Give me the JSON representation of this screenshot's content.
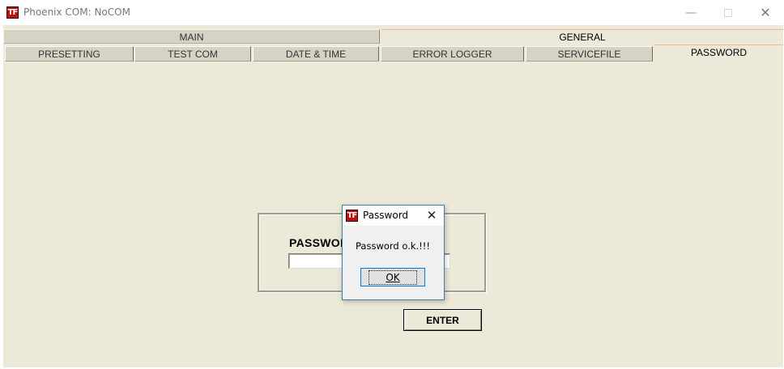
{
  "window": {
    "icon_text": "TF",
    "title": "Phoenix COM: NoCOM"
  },
  "tabs": {
    "main_tabs": [
      {
        "label": "MAIN",
        "selected": false
      },
      {
        "label": "GENERAL",
        "selected": true
      }
    ],
    "sub_tabs": [
      {
        "label": "PRESETTING",
        "selected": false
      },
      {
        "label": "TEST COM",
        "selected": false
      },
      {
        "label": "DATE & TIME",
        "selected": false
      },
      {
        "label": "ERROR LOGGER",
        "selected": false
      },
      {
        "label": "SERVICEFILE",
        "selected": false
      },
      {
        "label": "PASSWORD",
        "selected": true
      }
    ]
  },
  "password_panel": {
    "label": "PASSWORD",
    "input_value": "",
    "enter_label": "ENTER"
  },
  "dialog": {
    "icon_text": "TF",
    "title": "Password",
    "message": "Password o.k.!!!",
    "ok_label": "OK"
  },
  "colors": {
    "panel_background": "#ece9d8",
    "inactive_tab": "#d6d3c4",
    "selected_tab_highlight": "#f5b98a",
    "app_icon_red": "#c0100c",
    "dialog_border": "#3c7fb1",
    "focus_blue": "#0078d7"
  }
}
